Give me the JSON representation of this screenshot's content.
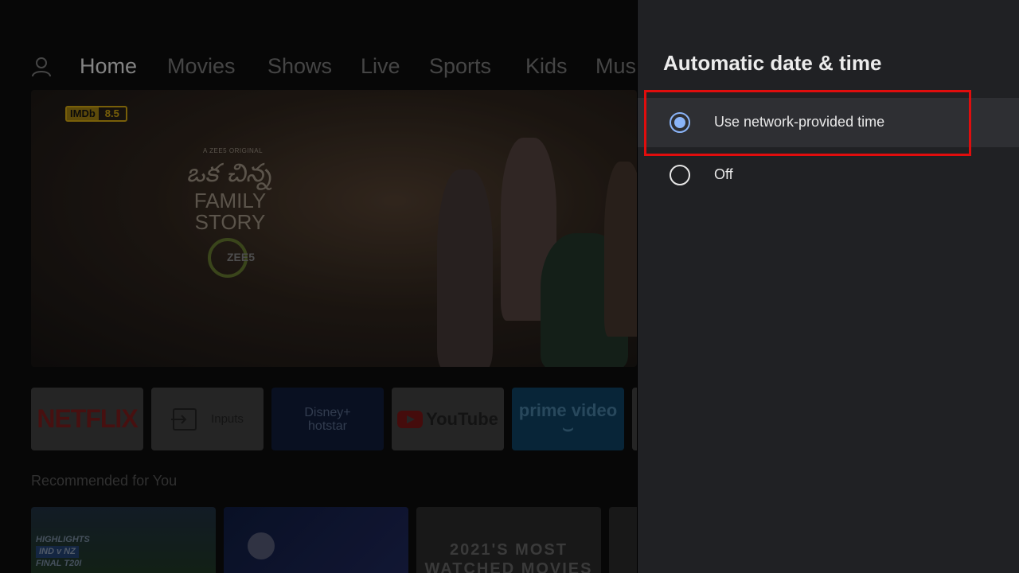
{
  "home": {
    "nav": {
      "tabs": [
        {
          "label": "Home",
          "active": true
        },
        {
          "label": "Movies"
        },
        {
          "label": "Shows"
        },
        {
          "label": "Live"
        },
        {
          "label": "Sports"
        },
        {
          "label": "Kids"
        },
        {
          "label": "Mus"
        }
      ]
    },
    "hero": {
      "imdb_label": "IMDb",
      "imdb_rating": "8.5",
      "original_label": "A ZEE5 ORIGINAL",
      "script_title": "ఒక చిన్న",
      "title_line1": "FAMILY",
      "title_line2": "STORY",
      "brand": "ZEE5"
    },
    "apps": {
      "netflix": "NETFLIX",
      "inputs": "Inputs",
      "hotstar_line1": "Disney+",
      "hotstar_line2": "hotstar",
      "youtube": "YouTube",
      "prime_line1": "prime video",
      "prime_line2": "⌣"
    },
    "recommended_label": "Recommended for You",
    "cards": {
      "c1_line1": "HIGHLIGHTS",
      "c1_line2": "IND v NZ",
      "c1_line3": "FINAL T20I",
      "c3_line1": "2021'S MOST",
      "c3_line2": "WATCHED MOVIES"
    }
  },
  "panel": {
    "heading": "Automatic date & time",
    "options": [
      {
        "label": "Use network-provided time",
        "selected": true
      },
      {
        "label": "Off",
        "selected": false
      }
    ]
  },
  "colors": {
    "panel_bg": "#202124",
    "accent": "#8ab4f8",
    "highlight": "#e00d0d"
  }
}
